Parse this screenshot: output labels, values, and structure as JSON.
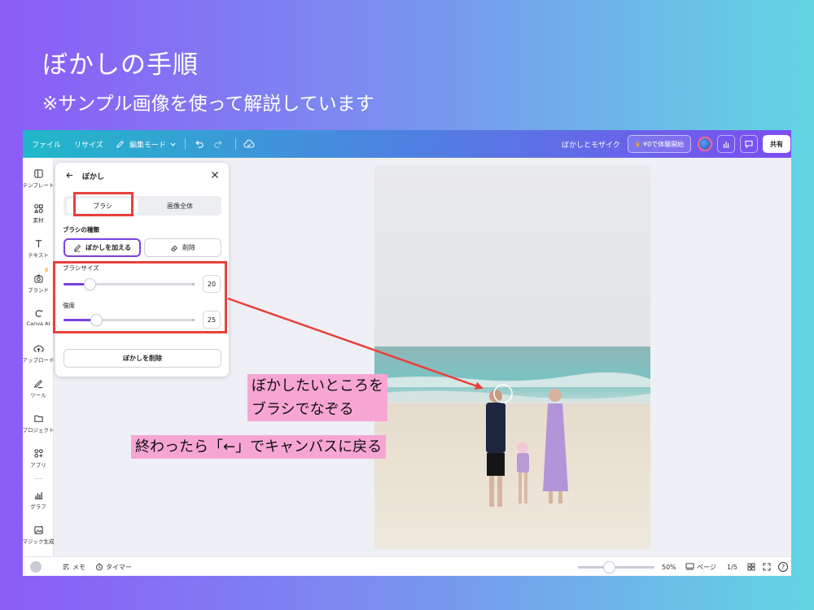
{
  "slide": {
    "title": "ぼかしの手順",
    "subtitle": "※サンプル画像を使って解説しています"
  },
  "topbar": {
    "file": "ファイル",
    "resize": "リサイズ",
    "edit_mode": "編集モード",
    "doc_title": "ぼかしとモザイク",
    "trial": "¥0で体験開始",
    "share": "共有"
  },
  "sidebar": {
    "items": [
      {
        "label": "テンプレート",
        "icon": "template-icon"
      },
      {
        "label": "素材",
        "icon": "elements-icon"
      },
      {
        "label": "テキスト",
        "icon": "text-icon"
      },
      {
        "label": "ブランド",
        "icon": "brand-icon"
      },
      {
        "label": "Canva AI",
        "icon": "canva-ai-icon"
      },
      {
        "label": "アップロード",
        "icon": "upload-icon"
      },
      {
        "label": "ツール",
        "icon": "tools-icon"
      },
      {
        "label": "プロジェクト",
        "icon": "folder-icon"
      },
      {
        "label": "アプリ",
        "icon": "apps-icon"
      },
      {
        "label": "グラフ",
        "icon": "chart-icon"
      },
      {
        "label": "マジック生成",
        "icon": "magic-icon"
      }
    ]
  },
  "panel": {
    "title": "ぼかし",
    "tab_brush": "ブラシ",
    "tab_whole": "画像全体",
    "brush_type_label": "ブラシの種類",
    "add_blur": "ぼかしを加える",
    "erase": "削除",
    "brush_size_label": "ブラシサイズ",
    "brush_size_value": "20",
    "brush_size_level": 0.2,
    "intensity_label": "強度",
    "intensity_value": "25",
    "intensity_level": 0.25,
    "remove_blur": "ぼかしを削除"
  },
  "bottombar": {
    "notes": "メモ",
    "timer": "タイマー",
    "zoom": "50%",
    "pages": "ページ",
    "page_count": "1/5"
  },
  "callouts": {
    "brush_line1": "ぼかしたいところを",
    "brush_line2": "ブラシでなぞる",
    "return": "終わったら「←」でキャンバスに戻る"
  },
  "colors": {
    "accent": "#7b3fe4",
    "highlight_box": "#e8413c",
    "callout_bg": "#f7a6d4"
  }
}
